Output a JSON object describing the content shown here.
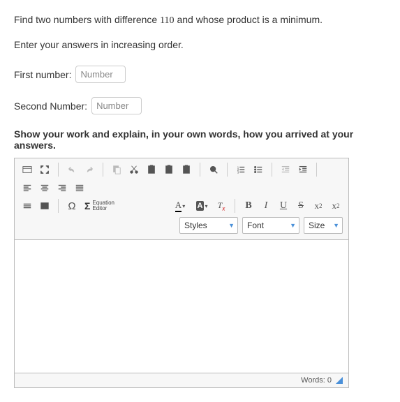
{
  "question": {
    "prefix": "Find two numbers with difference ",
    "value": "110",
    "suffix": " and whose product is a minimum."
  },
  "instruction": "Enter your answers in increasing order.",
  "fields": {
    "first": {
      "label": "First number:",
      "placeholder": "Number"
    },
    "second": {
      "label": "Second Number:",
      "placeholder": "Number"
    }
  },
  "show_work": "Show your work and explain, in your own words, how you arrived at your answers.",
  "editor": {
    "equation_label_top": "Equation",
    "equation_label_bottom": "Editor",
    "styles_label": "Styles",
    "font_label": "Font",
    "size_label": "Size",
    "letter_A": "A",
    "tx_T": "T",
    "tx_x": "x",
    "bold": "B",
    "italic": "I",
    "underline": "U",
    "strike": "S",
    "sub_x": "x",
    "sub_2": "2",
    "sup_x": "x",
    "sup_2": "2",
    "omega": "Ω",
    "sigma": "Σ"
  },
  "status": {
    "words_label": "Words: ",
    "count": "0"
  }
}
